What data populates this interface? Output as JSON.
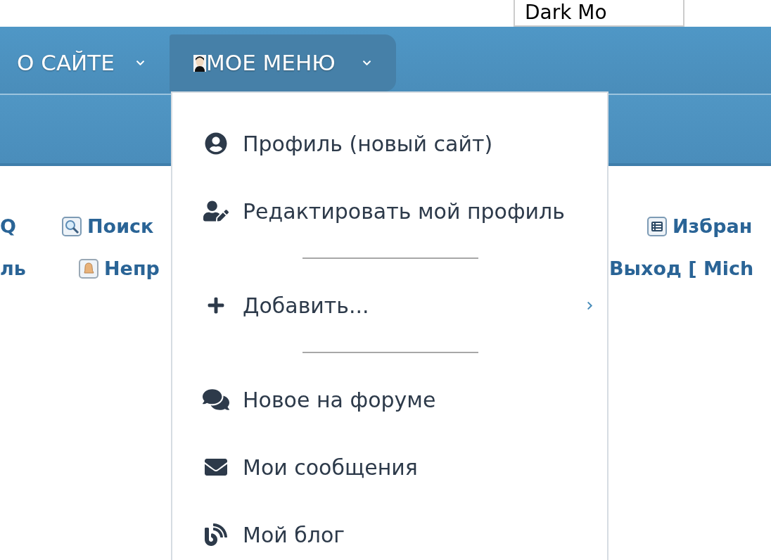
{
  "top_button": {
    "label": "Dark Mo"
  },
  "nav": [
    {
      "label": "О САЙТЕ",
      "selected": false
    },
    {
      "label": "МОЕ МЕНЮ",
      "selected": true
    }
  ],
  "link_rows": [
    [
      {
        "label": "Q"
      },
      {
        "label": "Поиск"
      },
      {
        "label": "Избран"
      }
    ],
    [
      {
        "label": "ль"
      },
      {
        "label": "Непр"
      },
      {
        "label": "Выход [ Mich"
      }
    ]
  ],
  "menu": {
    "items": [
      {
        "kind": "item",
        "label": "Профиль (новый сайт)"
      },
      {
        "kind": "item",
        "label": "Редактировать мой профиль"
      },
      {
        "kind": "divider"
      },
      {
        "kind": "submenu",
        "label": "Добавить..."
      },
      {
        "kind": "divider"
      },
      {
        "kind": "item",
        "label": "Новое на форуме"
      },
      {
        "kind": "item",
        "label": "Мои сообщения"
      },
      {
        "kind": "item",
        "label": "Мой блог"
      }
    ]
  }
}
